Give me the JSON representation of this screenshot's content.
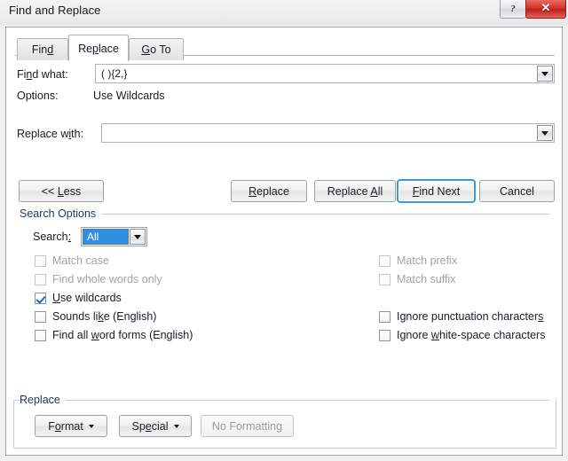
{
  "window": {
    "title": "Find and Replace",
    "help_button": "?",
    "close_button": "✕"
  },
  "tabs": [
    {
      "id": "find",
      "label": "Find",
      "accel_index": 3,
      "active": false
    },
    {
      "id": "replace",
      "label": "Replace",
      "accel_index": 2,
      "active": true
    },
    {
      "id": "goto",
      "label": "Go To",
      "accel_index": 0,
      "active": false
    }
  ],
  "find": {
    "label": "Find what:",
    "value": "( ){2,}",
    "dropdown_icon": "chevron-down-icon"
  },
  "options": {
    "label": "Options:",
    "value": "Use Wildcards"
  },
  "replace_with": {
    "label": "Replace with:",
    "value": "",
    "dropdown_icon": "chevron-down-icon"
  },
  "action_buttons": {
    "less": "<< Less",
    "replace": "Replace",
    "replace_all": "Replace All",
    "find_next": "Find Next",
    "cancel": "Cancel"
  },
  "search_options": {
    "title": "Search Options",
    "search_label": "Search:",
    "search_value": "All",
    "search_dropdown_icon": "chevron-down-icon",
    "left_checkboxes": [
      {
        "label": "Match case",
        "checked": false,
        "disabled": true
      },
      {
        "label": "Find whole words only",
        "checked": false,
        "disabled": true
      },
      {
        "label": "Use wildcards",
        "checked": true,
        "disabled": false
      },
      {
        "label": "Sounds like (English)",
        "checked": false,
        "disabled": false
      },
      {
        "label": "Find all word forms (English)",
        "checked": false,
        "disabled": false
      }
    ],
    "right_checkboxes": [
      {
        "label": "Match prefix",
        "checked": false,
        "disabled": true
      },
      {
        "label": "Match suffix",
        "checked": false,
        "disabled": true
      },
      {
        "label": "Ignore punctuation characters",
        "checked": false,
        "disabled": false
      },
      {
        "label": "Ignore white-space characters",
        "checked": false,
        "disabled": false
      }
    ]
  },
  "replace_group": {
    "title": "Replace",
    "format_button": "Format",
    "special_button": "Special",
    "no_formatting_button": "No Formatting"
  },
  "colors": {
    "dialog_bg": "#ffffff",
    "window_bg": "#f0f0f0",
    "group_title": "#1f3864",
    "selection_blue": "#2f8fe0",
    "focus_blue": "#3c9ad4",
    "close_red": "#d2342a",
    "check_blue": "#1f6fb5",
    "disabled_text": "#a3a3a3"
  }
}
